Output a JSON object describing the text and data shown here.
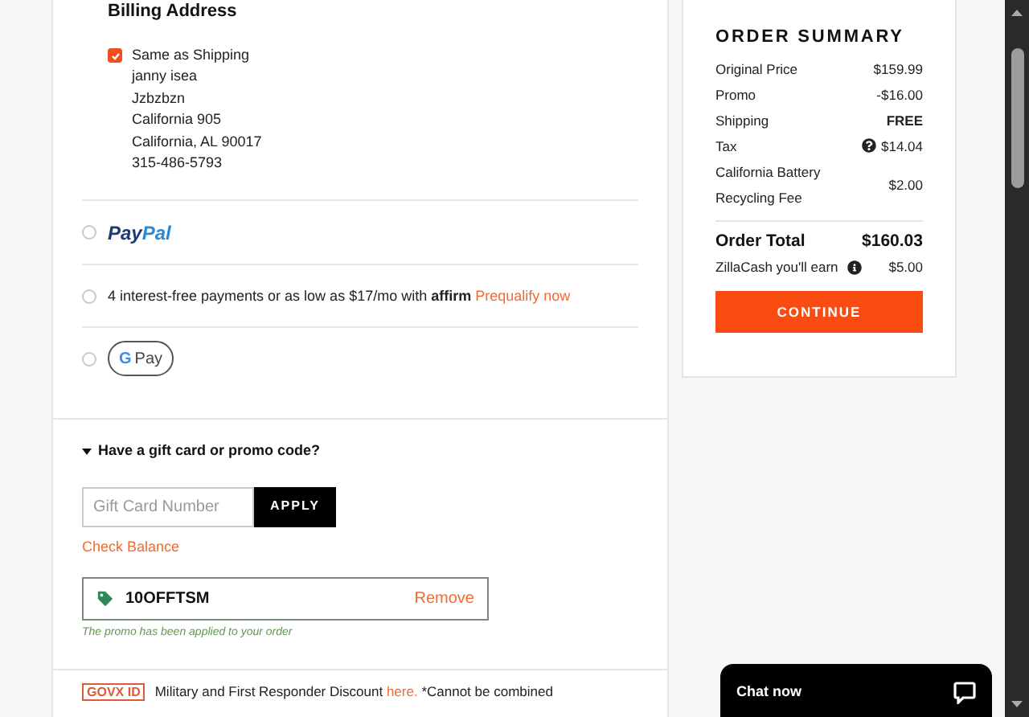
{
  "billing": {
    "title": "Billing Address",
    "same_as_shipping": {
      "label": "Same as Shipping",
      "checked": true
    },
    "address_lines": [
      "janny isea",
      "Jzbzbzn",
      "California 905",
      "California, AL 90017",
      "315-486-5793"
    ]
  },
  "payment_options": [
    {
      "kind": "paypal",
      "selected": false,
      "logo_parts": [
        "Pay",
        "Pal"
      ]
    },
    {
      "kind": "affirm",
      "selected": false,
      "text": "4 interest-free payments or as low as $17/mo with",
      "logo": "affirm",
      "link": "Prequalify now"
    },
    {
      "kind": "gpay",
      "selected": false,
      "logo_parts": [
        "G",
        "Pay"
      ]
    }
  ],
  "promo": {
    "toggle": "Have a gift card or promo code?",
    "expanded": true,
    "placeholder": "Gift Card Number",
    "apply": "APPLY",
    "check_balance": "Check Balance",
    "applied_code": "10OFFTSM",
    "remove": "Remove",
    "message": "The promo has been applied to your order"
  },
  "govx": {
    "logo": "GOVX ID",
    "text": "Military and First Responder Discount",
    "link": "here.",
    "note": "*Cannot be combined"
  },
  "summary": {
    "title": "ORDER SUMMARY",
    "rows": [
      {
        "label": "Original Price",
        "value": "$159.99",
        "bold": false,
        "info": false
      },
      {
        "label": "Promo",
        "value": "-$16.00",
        "bold": false,
        "info": false
      },
      {
        "label": "Shipping",
        "value": "FREE",
        "bold": true,
        "info": false
      },
      {
        "label": "Tax",
        "value": "$14.04",
        "bold": false,
        "info": true
      },
      {
        "label": "California Battery Recycling Fee",
        "value": "$2.00",
        "bold": false,
        "info": false
      }
    ],
    "total": {
      "label": "Order Total",
      "value": "$160.03"
    },
    "earn": {
      "label": "ZillaCash you'll earn",
      "value": "$5.00"
    },
    "button": "CONTINUE"
  },
  "chat": {
    "label": "Chat now"
  }
}
